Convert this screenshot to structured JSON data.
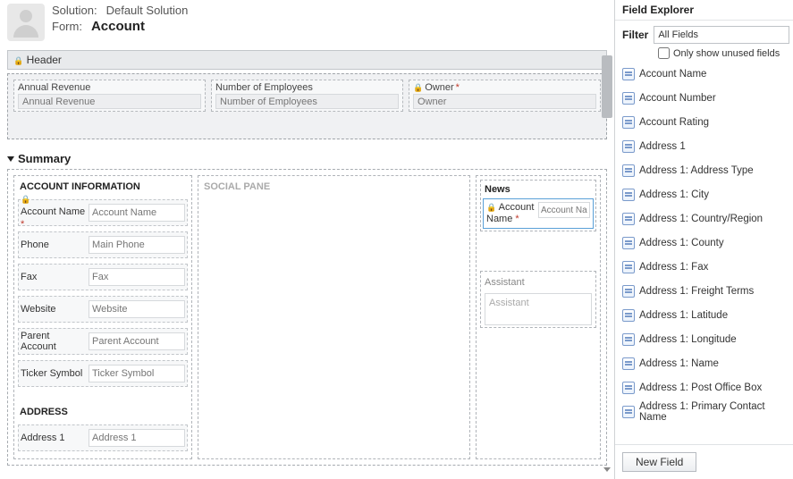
{
  "header": {
    "solution_label": "Solution:",
    "solution_value": "Default Solution",
    "form_label": "Form:",
    "form_value": "Account"
  },
  "form_header": {
    "title": "Header",
    "fields": [
      {
        "label": "Annual Revenue",
        "placeholder": "Annual Revenue",
        "locked": false,
        "required": false
      },
      {
        "label": "Number of Employees",
        "placeholder": "Number of Employees",
        "locked": false,
        "required": false
      },
      {
        "label": "Owner",
        "placeholder": "Owner",
        "locked": true,
        "required": true
      }
    ]
  },
  "tab": {
    "title": "Summary",
    "sections": {
      "account_info": {
        "title": "ACCOUNT INFORMATION",
        "fields": [
          {
            "label": "Account Name",
            "placeholder": "Account Name",
            "locked": true,
            "required": true
          },
          {
            "label": "Phone",
            "placeholder": "Main Phone"
          },
          {
            "label": "Fax",
            "placeholder": "Fax"
          },
          {
            "label": "Website",
            "placeholder": "Website"
          },
          {
            "label": "Parent Account",
            "placeholder": "Parent Account"
          },
          {
            "label": "Ticker Symbol",
            "placeholder": "Ticker Symbol"
          }
        ]
      },
      "social": {
        "title": "SOCIAL PANE"
      },
      "news": {
        "title": "News",
        "field": {
          "label": "Account Name",
          "placeholder": "Account Nam",
          "locked": true,
          "required": true
        }
      },
      "assistant": {
        "title": "Assistant",
        "placeholder": "Assistant"
      },
      "address": {
        "title": "ADDRESS",
        "fields": [
          {
            "label": "Address 1",
            "placeholder": "Address 1"
          }
        ]
      }
    }
  },
  "explorer": {
    "title": "Field Explorer",
    "filter_label": "Filter",
    "filter_value": "All Fields",
    "unused_label": "Only show unused fields",
    "fields": [
      "Account Name",
      "Account Number",
      "Account Rating",
      "Address 1",
      "Address 1: Address Type",
      "Address 1: City",
      "Address 1: Country/Region",
      "Address 1: County",
      "Address 1: Fax",
      "Address 1: Freight Terms",
      "Address 1: Latitude",
      "Address 1: Longitude",
      "Address 1: Name",
      "Address 1: Post Office Box",
      "Address 1: Primary Contact Name"
    ],
    "new_field_button": "New Field"
  }
}
